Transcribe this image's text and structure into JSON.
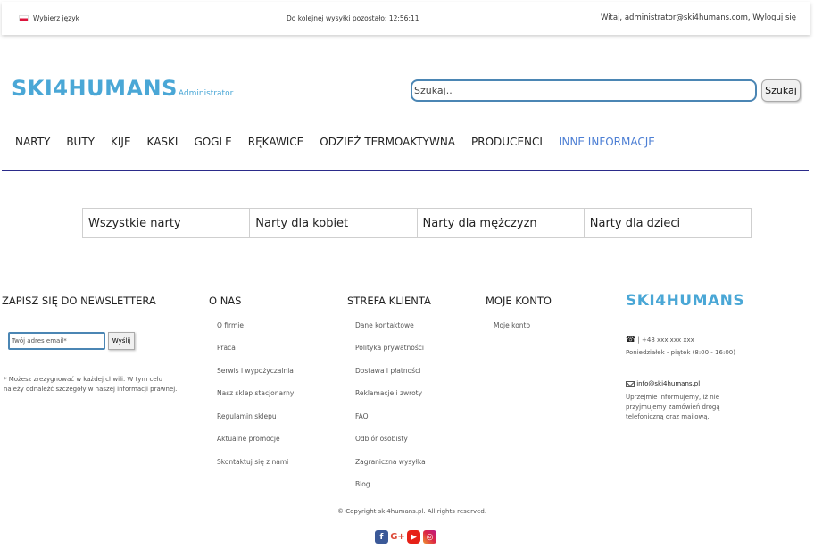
{
  "topbar": {
    "language_label": "Wybierz język",
    "countdown_text": "Do kolejnej wysyłki pozostało: 12:56:11",
    "greeting_text": "Witaj, administrator@ski4humans.com, Wyloguj się"
  },
  "header": {
    "logo_text": "SKI4HUMANS",
    "logo_subtext": "Administrator",
    "search_placeholder": "Szukaj..",
    "search_button": "Szukaj"
  },
  "nav": {
    "items": [
      "NARTY",
      "BUTY",
      "KIJE",
      "KASKI",
      "GOGLE",
      "RĘKAWICE",
      "ODZIEŻ TERMOAKTYWNA",
      "PRODUCENCI",
      "INNE INFORMACJE"
    ]
  },
  "categories": [
    "Wszystkie narty",
    "Narty dla kobiet",
    "Narty dla mężczyzn",
    "Narty dla dzieci"
  ],
  "footer": {
    "newsletter_heading": "ZAPISZ SIĘ DO NEWSLETTERA",
    "email_placeholder": "Twój adres email*",
    "send_button": "Wyślij",
    "newsletter_note": "* Możesz zrezygnować w każdej chwili. W tym celu należy odnaleźć szczegóły w naszej informacji prawnej.",
    "about_heading": "O NAS",
    "about_links": [
      "O firmie",
      "Praca",
      "Serwis i wypożyczalnia",
      "Nasz sklep stacjonarny",
      "Regulamin sklepu",
      "Aktualne promocje",
      "Skontaktuj się z nami"
    ],
    "client_heading": "STREFA KLIENTA",
    "client_links": [
      "Dane kontaktowe",
      "Polityka prywatności",
      "Dostawa i płatności",
      "Reklamacje i zwroty",
      "FAQ",
      "Odbiór osobisty",
      "Zagraniczna wysyłka",
      "Blog"
    ],
    "account_heading": "MOJE KONTO",
    "account_links": [
      "Moje konto"
    ],
    "logo_text": "SKI4HUMANS",
    "phone": "| +48 xxx xxx xxx",
    "hours": "Poniedziałek - piątek (8:00 - 16:00)",
    "email": "info@ski4humans.pl",
    "info_line1": "Uprzejmie informujemy, iż nie",
    "info_line2": "przyjmujemy zamówień drogą",
    "info_line3": "telefoniczną oraz mailową.",
    "copyright": "© Copyright ski4humans.pl. All rights reserved.",
    "socials": [
      "facebook-icon",
      "google-plus-icon",
      "youtube-icon",
      "instagram-icon"
    ]
  },
  "colors": {
    "brand": "#4aa7d6",
    "nav_active": "#4d7fd4",
    "nav_line": "#2b2b8a"
  }
}
